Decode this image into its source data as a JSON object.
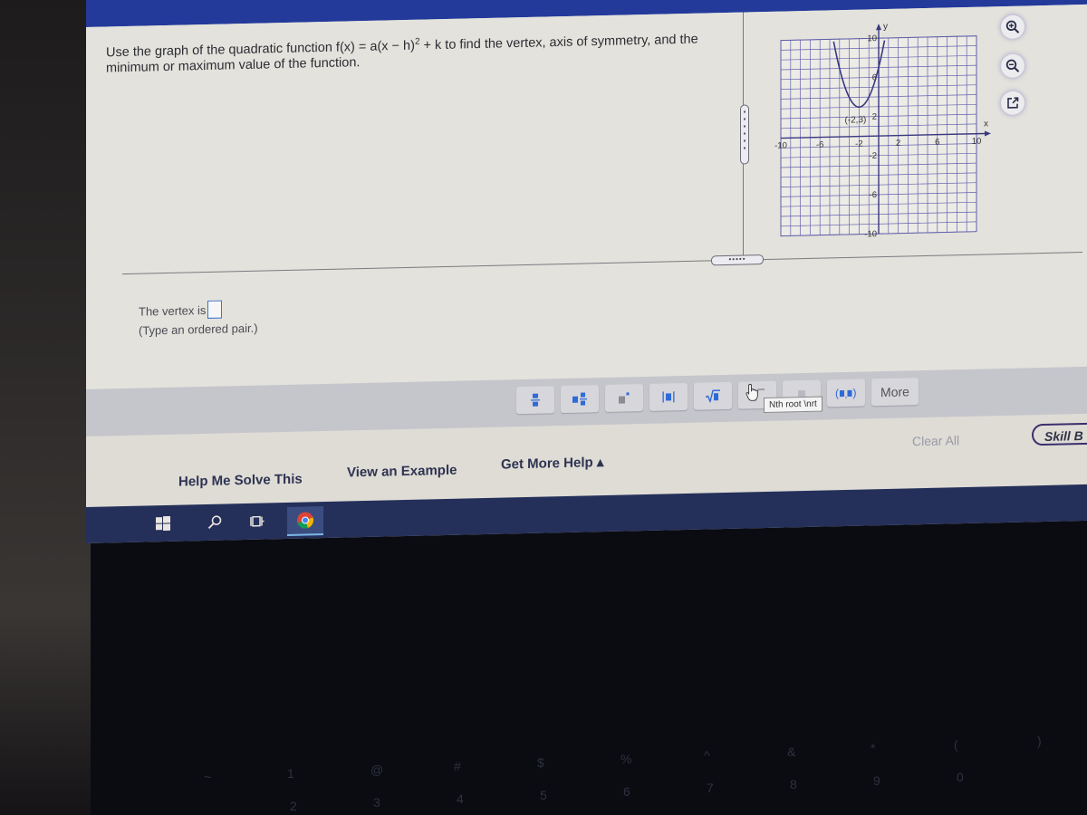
{
  "question": {
    "text_before": "Use the graph of the quadratic function f(x) = a(x − h)",
    "exponent": "2",
    "text_after": " + k to find the vertex, axis of symmetry, and the minimum or maximum value of the function."
  },
  "graph": {
    "x_axis_label": "x",
    "y_axis_label": "y",
    "x_ticks": [
      "-10",
      "-6",
      "-2",
      "2",
      "6",
      "10"
    ],
    "y_ticks": [
      "10",
      "6",
      "2",
      "-2",
      "-6",
      "-10"
    ],
    "vertex_label": "(-2,3)"
  },
  "chart_data": {
    "type": "line",
    "title": "",
    "xlabel": "x",
    "ylabel": "y",
    "xlim": [
      -10,
      10
    ],
    "ylim": [
      -10,
      10
    ],
    "grid": true,
    "series": [
      {
        "name": "f(x) = (x + 2)^2 + 3",
        "vertex": [
          -2,
          3
        ],
        "a": 1,
        "h": -2,
        "k": 3
      }
    ],
    "annotations": [
      {
        "text": "(-2,3)",
        "x": -2,
        "y": 3
      }
    ]
  },
  "tools": {
    "zoom_in": "zoom-in",
    "zoom_out": "zoom-out",
    "popout": "open-in-new-window"
  },
  "answer": {
    "label": "The vertex is",
    "value": "",
    "hint": "(Type an ordered pair.)"
  },
  "palette": {
    "buttons": [
      {
        "name": "fraction",
        "glyph": "▪̶"
      },
      {
        "name": "mixed-number",
        "glyph": "▪▪"
      },
      {
        "name": "exponent",
        "glyph": "▪'"
      },
      {
        "name": "absolute-value",
        "glyph": "|▪|"
      },
      {
        "name": "square-root",
        "glyph": "√▪"
      },
      {
        "name": "nth-root",
        "glyph": "ⁿ√"
      },
      {
        "name": "decimal",
        "glyph": "▪"
      },
      {
        "name": "ordered-pair",
        "glyph": "(▪,▪)"
      }
    ],
    "more_label": "More",
    "tooltip": "Nth root  \\nrt"
  },
  "footer": {
    "help_me_solve": "Help Me Solve This",
    "view_example": "View an Example",
    "get_more_help": "Get More Help ▴",
    "clear_all": "Clear All",
    "skill_builder": "Skill B"
  },
  "keyboard": {
    "number_row": [
      "~",
      "1",
      "@",
      "#",
      "$",
      "%",
      "^",
      "&",
      "*",
      "(",
      ")"
    ],
    "numbers": [
      "2",
      "3",
      "4",
      "5",
      "6",
      "7",
      "8",
      "9",
      "0"
    ]
  }
}
